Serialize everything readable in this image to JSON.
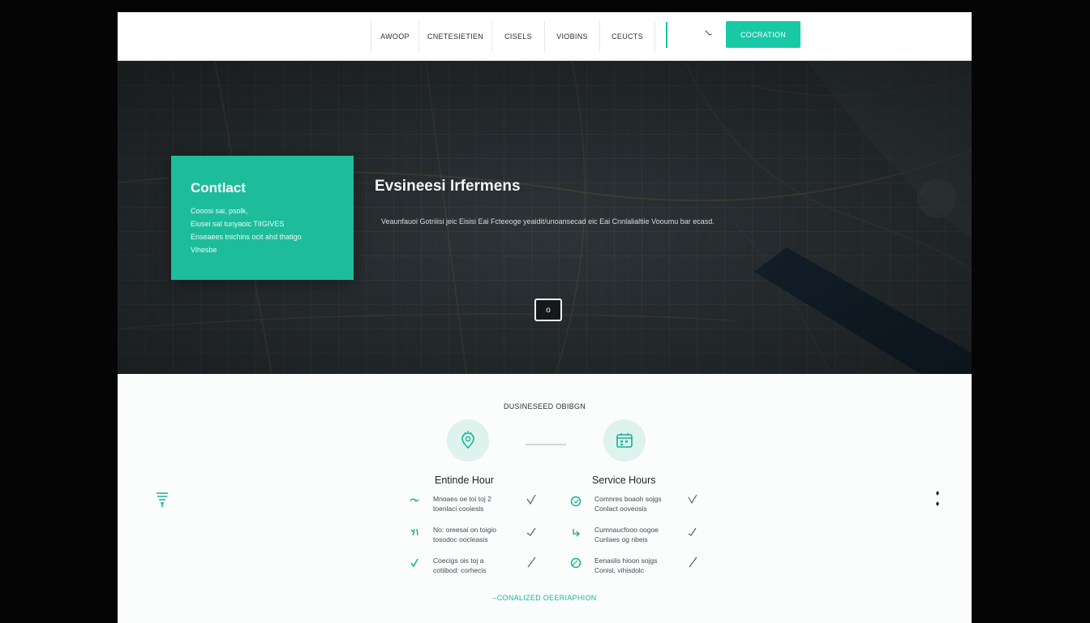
{
  "header": {
    "nav": [
      {
        "label": "AWOOP"
      },
      {
        "label": "CNETESIETIEN"
      },
      {
        "label": "CISELS"
      },
      {
        "label": "VIOBINS"
      },
      {
        "label": "CEUCTS"
      }
    ],
    "cta_label": "COCRATION",
    "search_icon": "search-icon",
    "accent_color": "#18c9a7"
  },
  "hero": {
    "contact": {
      "title": "Contlact",
      "lines": [
        "Cooosi sai, psolk,",
        "Eiusei saI tunyaoic TIIGIVES",
        "Enseaees tnichins ocit ahd thatigo",
        "Vihesbe"
      ]
    },
    "title": "Evsineesi Irfermens",
    "description": "Veaunfauoi Gotriiisi jeic Eisisi Eai Fcteeoge yeaidit/unoansecad eic Eai Cnnlalialtiie Vooumu bar ecasd.",
    "pin_label": "o"
  },
  "info": {
    "section_title": "DUSINESEED OBIBGN",
    "columns": [
      {
        "heading": "Entinde Hour",
        "rows": [
          {
            "line1": "Mnoaes oe toi toj 2",
            "line2": "toenlaci cooiesls"
          },
          {
            "line1": "No: oreesai on toigio",
            "line2": "tosodoc oocleasis"
          },
          {
            "line1": "Coecigs ois toj a",
            "line2": "cotiibod: corhecis"
          }
        ]
      },
      {
        "heading": "Service Hours",
        "rows": [
          {
            "line1": "Comnres boaoh sojgs",
            "line2": "Conlact ooveosis"
          },
          {
            "line1": "Cumnaucfooo oogoe",
            "line2": "Cunlaes og nbeis"
          },
          {
            "line1": "Eenaslis hioon sojgs",
            "line2": "Conisl, vihisdolc"
          }
        ]
      }
    ],
    "footer_link": "–CONALIZED OEERIAPHION"
  }
}
